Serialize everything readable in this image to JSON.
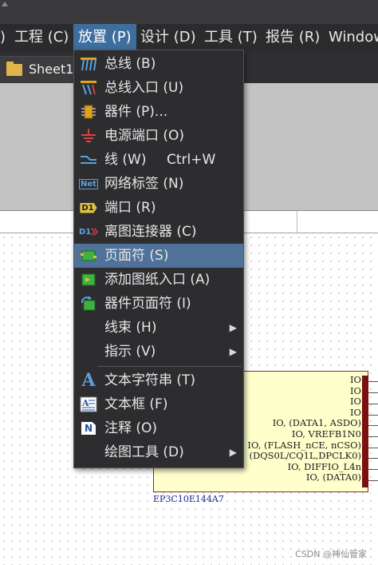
{
  "menubar": {
    "items": [
      {
        "label": ") "
      },
      {
        "label": "工程 (C)"
      },
      {
        "label": "放置 (P)"
      },
      {
        "label": "设计 (D)"
      },
      {
        "label": "工具 (T)"
      },
      {
        "label": "报告 (R)"
      },
      {
        "label": "Window"
      }
    ]
  },
  "tab": {
    "label": "Sheet1."
  },
  "place_menu": {
    "items": [
      {
        "label": "总线 (B)",
        "icon": "bus-icon"
      },
      {
        "label": "总线入口 (U)",
        "icon": "bus-entry-icon"
      },
      {
        "label": "器件 (P)...",
        "icon": "part-icon"
      },
      {
        "label": "电源端口 (O)",
        "icon": "power-port-icon"
      },
      {
        "label": "线 (W)",
        "shortcut": "Ctrl+W",
        "icon": "wire-icon"
      },
      {
        "label": "网络标签 (N)",
        "icon": "net-label-icon",
        "icon_text": "Net"
      },
      {
        "label": "端口 (R)",
        "icon": "port-icon",
        "icon_text": "D1"
      },
      {
        "label": "离图连接器 (C)",
        "icon": "off-sheet-connector-icon",
        "icon_text": "D1"
      },
      {
        "label": "页面符 (S)",
        "icon": "sheet-symbol-icon",
        "highlighted": true
      },
      {
        "label": "添加图纸入口 (A)",
        "icon": "sheet-entry-icon"
      },
      {
        "label": "器件页面符 (I)",
        "icon": "device-sheet-symbol-icon"
      },
      {
        "label": "线束 (H)",
        "submenu": true
      },
      {
        "label": "指示 (V)",
        "submenu": true
      },
      {
        "label": "文本字符串 (T)",
        "icon": "text-string-icon",
        "icon_text": "A"
      },
      {
        "label": "文本框 (F)",
        "icon": "text-frame-icon"
      },
      {
        "label": "注释 (O)",
        "icon": "note-icon",
        "icon_text": "N"
      },
      {
        "label": "绘图工具 (D)",
        "submenu": true
      }
    ]
  },
  "component": {
    "name": "EP3C10E144A7",
    "pins": [
      "IO",
      "IO",
      "IO",
      "IO",
      "IO, (DATA1, ASDO)",
      "IO, VREFB1N0",
      "IO, (FLASH_nCE, nCSO)",
      "(DQS0L/CQ1L,DPCLK0)",
      "IO, DIFFIO_L4n",
      "IO, (DATA0)"
    ]
  },
  "watermark": "CSDN @神仙管家",
  "colors": {
    "menu_bg": "#2d2d30",
    "highlight": "#50729a",
    "menubar_active": "#3e6e9e",
    "component_fill": "#ffffcc",
    "component_border": "#7a3030",
    "component_name": "#1a2a9a"
  }
}
